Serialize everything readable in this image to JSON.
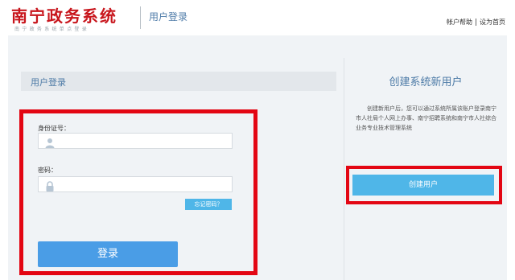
{
  "header": {
    "brand_title": "南宁政务系统",
    "brand_subtitle": "南宁政务系统单点登录",
    "page_name": "用户登录",
    "links": [
      "帐户帮助",
      "设为首页"
    ]
  },
  "login": {
    "panel_title": "用户登录",
    "id_label": "身份证号：",
    "id_value": "",
    "id_icon": "user-icon",
    "password_label": "密码：",
    "password_value": "",
    "password_icon": "lock-icon",
    "forgot_label": "忘记密码？",
    "submit_label": "登录"
  },
  "register": {
    "title": "创建系统新用户",
    "description": "创建新用户后，您可以通过系统所属该账户登录南宁市人社局个人网上办事、南宁招聘系统和南宁市人社综合业务专业技术管理系统",
    "button_label": "创建用户"
  },
  "colors": {
    "brand_red": "#c8161d",
    "highlight_red": "#e30613",
    "primary_blue": "#4a9de6",
    "light_blue": "#4fb6e8",
    "title_blue": "#4c7aa6"
  }
}
